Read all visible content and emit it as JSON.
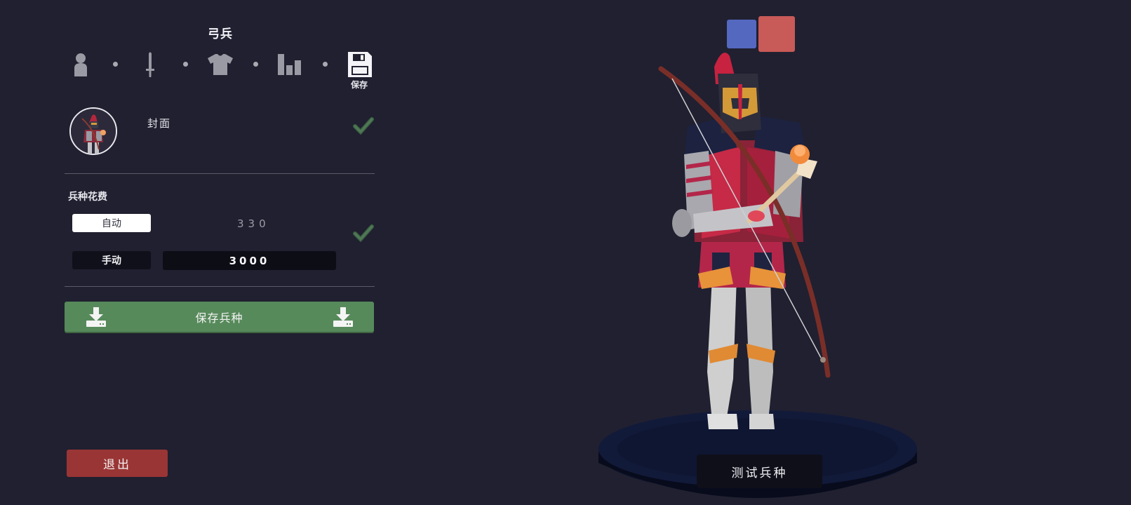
{
  "unit_name": "弓兵",
  "steps": [
    {
      "icon": "person-icon"
    },
    {
      "icon": "sword-icon"
    },
    {
      "icon": "shirt-icon"
    },
    {
      "icon": "stats-bars-icon"
    },
    {
      "icon": "floppy-disk-icon",
      "label": "保存"
    }
  ],
  "cover": {
    "label": "封面",
    "confirmed": true
  },
  "cost": {
    "title": "兵种花费",
    "auto_label": "自动",
    "auto_value": "330",
    "manual_label": "手动",
    "manual_value": "3000",
    "confirmed": true
  },
  "save_unit_label": "保存兵种",
  "exit_label": "退出",
  "test_unit_label": "测试兵种",
  "team_colors": {
    "blue": "#5468c0",
    "red": "#c85a58"
  },
  "colors": {
    "background": "#202030",
    "save_green": "#578a5b",
    "exit_red": "#9a3535"
  }
}
